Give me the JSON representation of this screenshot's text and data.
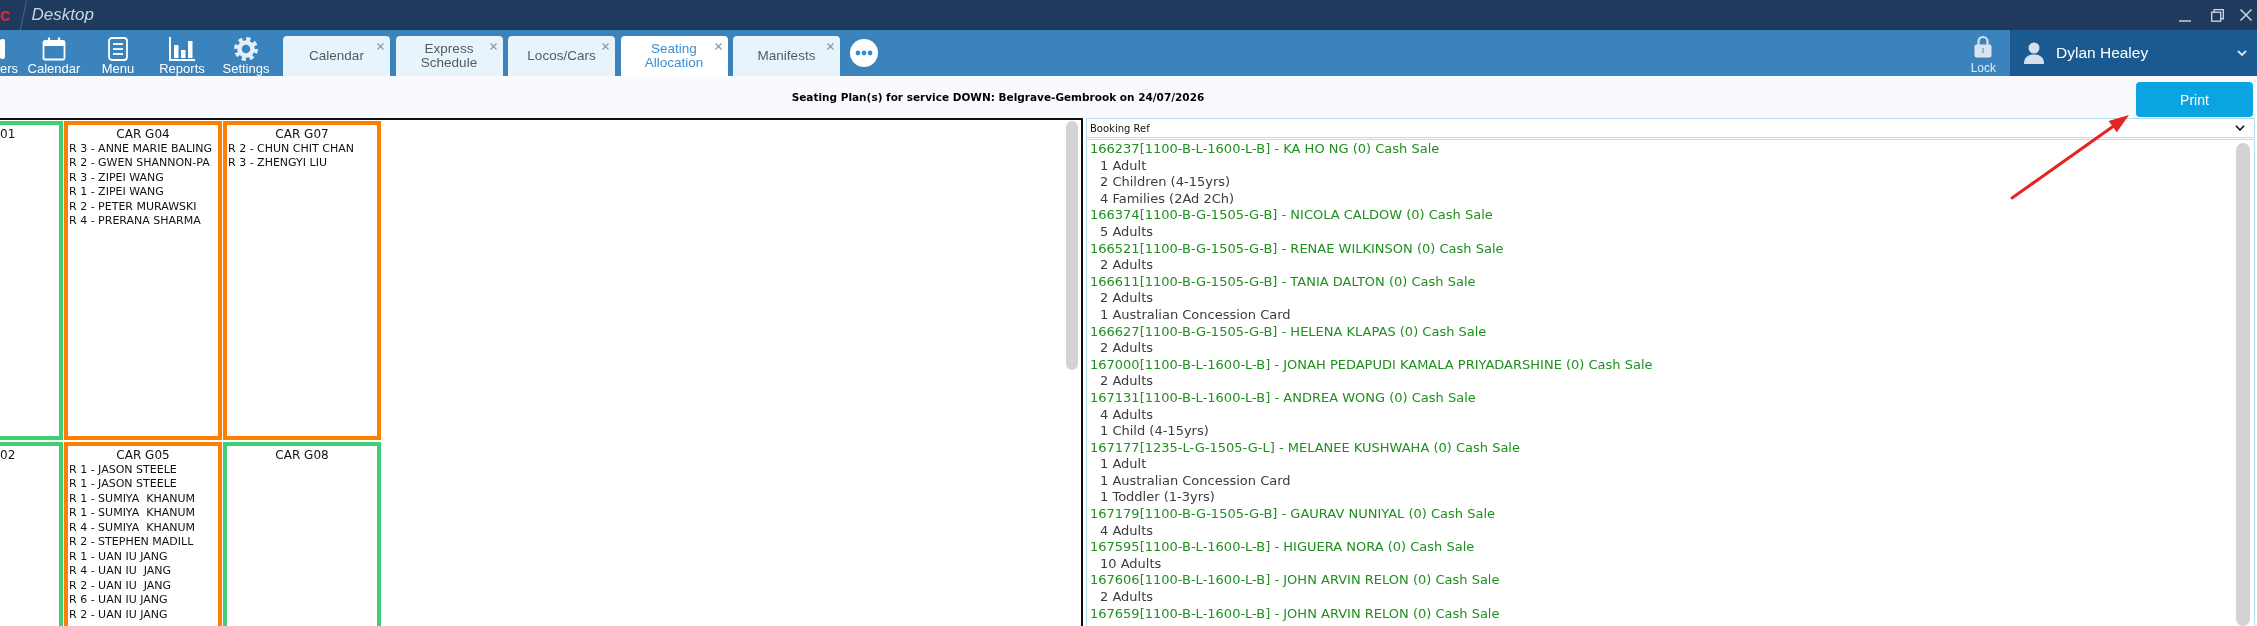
{
  "window": {
    "logo": "c",
    "title": "Desktop"
  },
  "toolbar": [
    {
      "kind": "cropped",
      "label": "ers"
    },
    {
      "kind": "calendar",
      "label": "Calendar"
    },
    {
      "kind": "menu",
      "label": "Menu"
    },
    {
      "kind": "reports",
      "label": "Reports"
    },
    {
      "kind": "settings",
      "label": "Settings"
    }
  ],
  "tabs": [
    {
      "label": "Calendar",
      "selected": false
    },
    {
      "label": "Express Schedule",
      "selected": false
    },
    {
      "label": "Locos/Cars",
      "selected": false
    },
    {
      "label": "Seating Allocation",
      "selected": true
    },
    {
      "label": "Manifests",
      "selected": false
    }
  ],
  "lock": {
    "label": "Lock"
  },
  "user": {
    "name": "Dylan Healey"
  },
  "header": {
    "title": "Seating Plan(s) for service DOWN: Belgrave-Gembrook on 24/07/2026",
    "print_button": "Print"
  },
  "seating_plan": {
    "cars": [
      {
        "title": "01",
        "color": "#3ecf74"
      },
      {
        "title": "CAR G04",
        "color": "#ff8000",
        "passengers": [
          "R 3 - ANNE MARIE BALING",
          "R 2 - GWEN SHANNON-PA",
          "R 3 - ZIPEI WANG",
          "R 1 - ZIPEI WANG",
          "R 2 - PETER MURAWSKI",
          "R 4 - PRERANA SHARMA"
        ]
      },
      {
        "title": "CAR G07",
        "color": "#ff8000",
        "passengers": [
          "R 2 - CHUN CHIT CHAN",
          "R 3 - ZHENGYI LIU"
        ]
      },
      {
        "title": "02",
        "color": "#3ecf74"
      },
      {
        "title": "CAR G05",
        "color": "#ff8000",
        "passengers": [
          "R 1 - JASON STEELE",
          "R 1 - JASON STEELE",
          "R 1 - SUMIYA  KHANUM",
          "R 1 - SUMIYA  KHANUM",
          "R 4 - SUMIYA  KHANUM",
          "R 2 - STEPHEN MADILL",
          "R 1 - UAN IU JANG",
          "R 4 - UAN IU  JANG",
          "R 2 - UAN IU  JANG",
          "R 6 - UAN IU JANG",
          "R 2 - UAN IU JANG"
        ]
      },
      {
        "title": "CAR G08",
        "color": "#3ecf74"
      }
    ]
  },
  "booking_list": {
    "sort_field": "Booking Ref",
    "bookings": [
      {
        "ref": "166237[1100-B-L-1600-L-B] - KA HO NG (0) Cash Sale",
        "passengers": [
          "1 Adult",
          "2 Children (4-15yrs)",
          "4 Families (2Ad 2Ch)"
        ]
      },
      {
        "ref": "166374[1100-B-G-1505-G-B] - NICOLA CALDOW (0) Cash Sale",
        "passengers": [
          "5 Adults"
        ]
      },
      {
        "ref": "166521[1100-B-G-1505-G-B] - RENAE WILKINSON (0) Cash Sale",
        "passengers": [
          "2 Adults"
        ]
      },
      {
        "ref": "166611[1100-B-G-1505-G-B] - TANIA DALTON (0) Cash Sale",
        "passengers": [
          "2 Adults",
          "1 Australian Concession Card"
        ]
      },
      {
        "ref": "166627[1100-B-G-1505-G-B] - HELENA KLAPAS (0) Cash Sale",
        "passengers": [
          "2 Adults"
        ]
      },
      {
        "ref": "167000[1100-B-L-1600-L-B] - JONAH PEDAPUDI KAMALA PRIYADARSHINE (0) Cash Sale",
        "passengers": [
          "2 Adults"
        ]
      },
      {
        "ref": "167131[1100-B-L-1600-L-B] - ANDREA WONG (0) Cash Sale",
        "passengers": [
          "4 Adults",
          "1 Child (4-15yrs)"
        ]
      },
      {
        "ref": "167177[1235-L-G-1505-G-L] - MELANEE KUSHWAHA (0) Cash Sale",
        "passengers": [
          "1 Adult",
          "1 Australian Concession Card",
          "1 Toddler (1-3yrs)"
        ]
      },
      {
        "ref": "167179[1100-B-G-1505-G-B] - GAURAV NUNIYAL (0) Cash Sale",
        "passengers": [
          "4 Adults"
        ]
      },
      {
        "ref": "167595[1100-B-L-1600-L-B] - HIGUERA NORA (0) Cash Sale",
        "passengers": [
          "10 Adults"
        ]
      },
      {
        "ref": "167606[1100-B-L-1600-L-B] - JOHN ARVIN RELON (0) Cash Sale",
        "passengers": [
          "2 Adults"
        ]
      },
      {
        "ref": "167659[1100-B-L-1600-L-B] - JOHN ARVIN RELON (0) Cash Sale"
      }
    ]
  }
}
